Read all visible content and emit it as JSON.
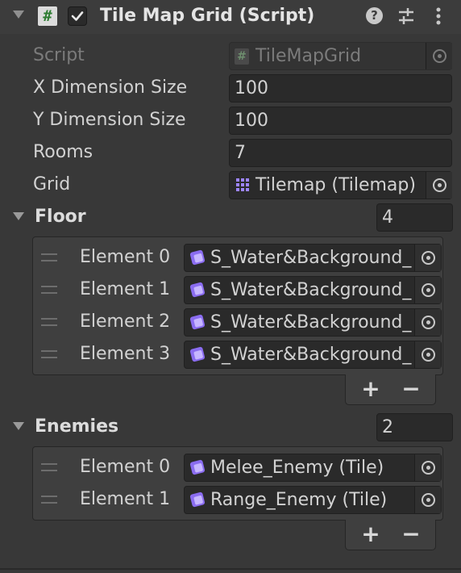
{
  "component": {
    "title": "Tile Map Grid (Script)",
    "script_icon": "#",
    "enabled": true
  },
  "fields": {
    "script": {
      "label": "Script",
      "value": "TileMapGrid",
      "icon": "#"
    },
    "x_dim": {
      "label": "X Dimension Size",
      "value": "100"
    },
    "y_dim": {
      "label": "Y Dimension Size",
      "value": "100"
    },
    "rooms": {
      "label": "Rooms",
      "value": "7"
    },
    "grid": {
      "label": "Grid",
      "value": "Tilemap (Tilemap)"
    }
  },
  "floor": {
    "label": "Floor",
    "size": "4",
    "elements": [
      {
        "label": "Element 0",
        "value": "S_Water&Background_"
      },
      {
        "label": "Element 1",
        "value": "S_Water&Background_"
      },
      {
        "label": "Element 2",
        "value": "S_Water&Background_"
      },
      {
        "label": "Element 3",
        "value": "S_Water&Background_"
      }
    ],
    "add": "+",
    "remove": "−"
  },
  "enemies": {
    "label": "Enemies",
    "size": "2",
    "elements": [
      {
        "label": "Element 0",
        "value": "Melee_Enemy (Tile)"
      },
      {
        "label": "Element 1",
        "value": "Range_Enemy (Tile)"
      }
    ],
    "add": "+",
    "remove": "−"
  },
  "icons": {
    "header_fold": "chevron-down-icon",
    "help": "help-icon",
    "presets": "sliders-icon",
    "menu": "kebab-menu-icon",
    "object_picker": "object-picker-icon",
    "tile": "tile-asset-icon",
    "tilemap": "tilemap-grid-icon",
    "drag": "drag-handle-icon"
  },
  "colors": {
    "background": "#383838",
    "field": "#2a2a2a",
    "text": "#d2d2d2",
    "disabled_text": "#7b7b7b",
    "tile_icon": "#8a6cf0"
  }
}
